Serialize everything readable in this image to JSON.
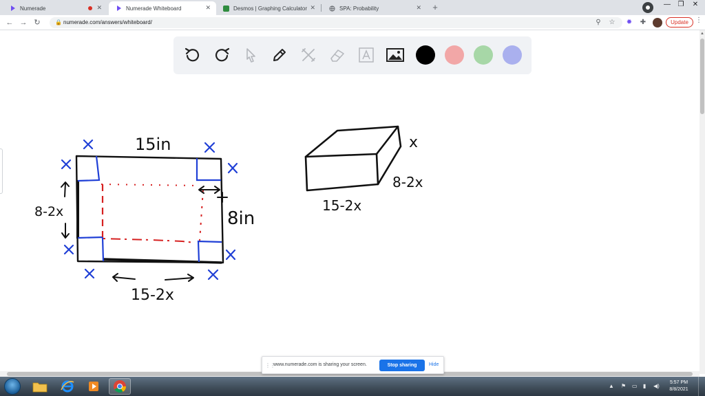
{
  "tabs": [
    {
      "label": "Numerade",
      "active": false
    },
    {
      "label": "Numerade Whiteboard",
      "active": true
    },
    {
      "label": "Desmos | Graphing Calculator",
      "active": false
    },
    {
      "label": "SPA: Probability",
      "active": false
    }
  ],
  "toolbar": {
    "url": "numerade.com/answers/whiteboard/",
    "update_label": "Update"
  },
  "whiteboard": {
    "swatch_colors": [
      "#000000",
      "#f2a7a7",
      "#a7d7a7",
      "#aab0ee"
    ],
    "flat_sheet": {
      "top_label": "15in",
      "right_label": "8in",
      "left_label": "8-2x",
      "bottom_label": "15-2x",
      "corner_mark": "x"
    },
    "box": {
      "height_label": "x",
      "depth_label": "8-2x",
      "length_label": "15-2x"
    }
  },
  "sharing_bar": {
    "message": "www.numerade.com is sharing your screen.",
    "stop_label": "Stop sharing",
    "hide_label": "Hide"
  },
  "taskbar": {
    "time": "5:57 PM",
    "date": "8/8/2021"
  }
}
